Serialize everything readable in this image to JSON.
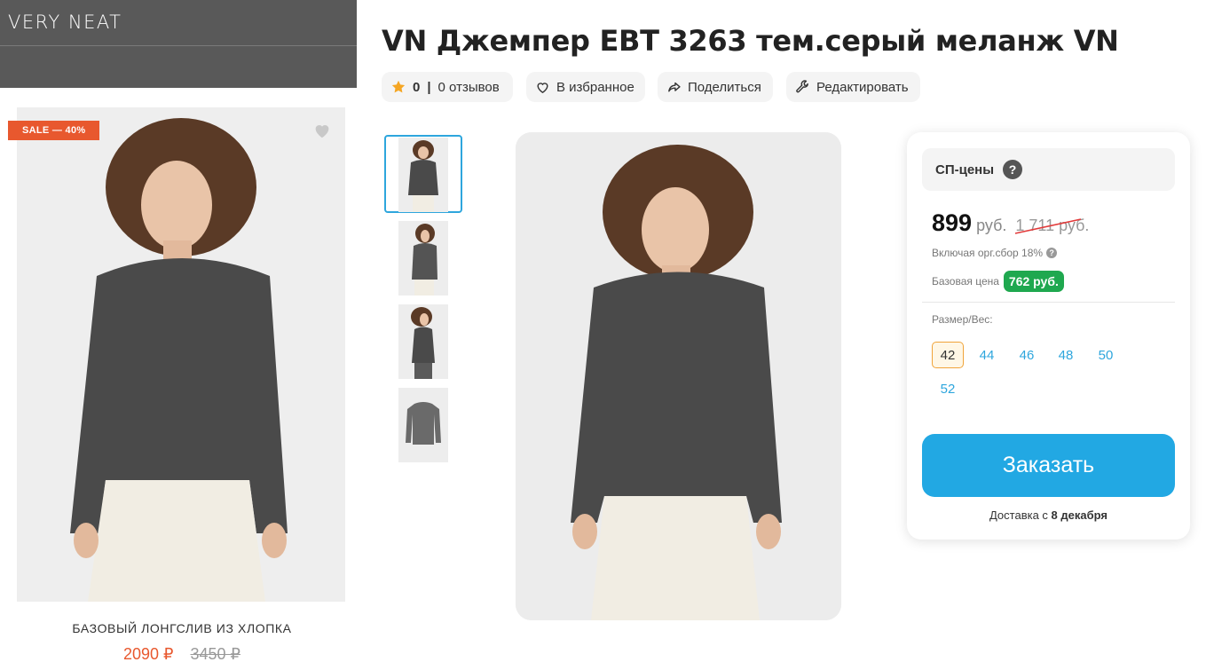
{
  "promo": {
    "brand": "VERY NEAT",
    "sale_badge": "SALE — 40%",
    "title": "БАЗОВЫЙ ЛОНГСЛИВ ИЗ ХЛОПКА",
    "price_new": "2090 ₽",
    "price_old": "3450 ₽",
    "accent_color": "#e8582e"
  },
  "product": {
    "title": "VN Джемпер ЕВТ 3263 тем.серый меланж VN",
    "rating_count": "0",
    "rating_separator": "|",
    "reviews": "0 отзывов",
    "favorite": "В избранное",
    "share": "Поделиться",
    "edit": "Редактировать"
  },
  "gallery": {
    "thumbnails": [
      "front-view",
      "side-view",
      "profile-view",
      "flat-view"
    ],
    "selected_index": 0
  },
  "price_card": {
    "sp_label": "СП-цены",
    "sp_help": "?",
    "price": "899",
    "currency": "руб.",
    "old_price": "1 711 руб.",
    "fee_note": "Включая орг.сбор 18%",
    "fee_help": "?",
    "base_label": "Базовая цена",
    "base_price": "762 руб.",
    "size_label": "Размер/Вес:",
    "sizes": [
      "42",
      "44",
      "46",
      "48",
      "50",
      "52"
    ],
    "selected_size": "42",
    "order_button": "Заказать",
    "delivery_prefix": "Доставка с",
    "delivery_date": "8 декабря",
    "accent_color": "#22a8e3",
    "base_badge_color": "#1fa84f"
  }
}
